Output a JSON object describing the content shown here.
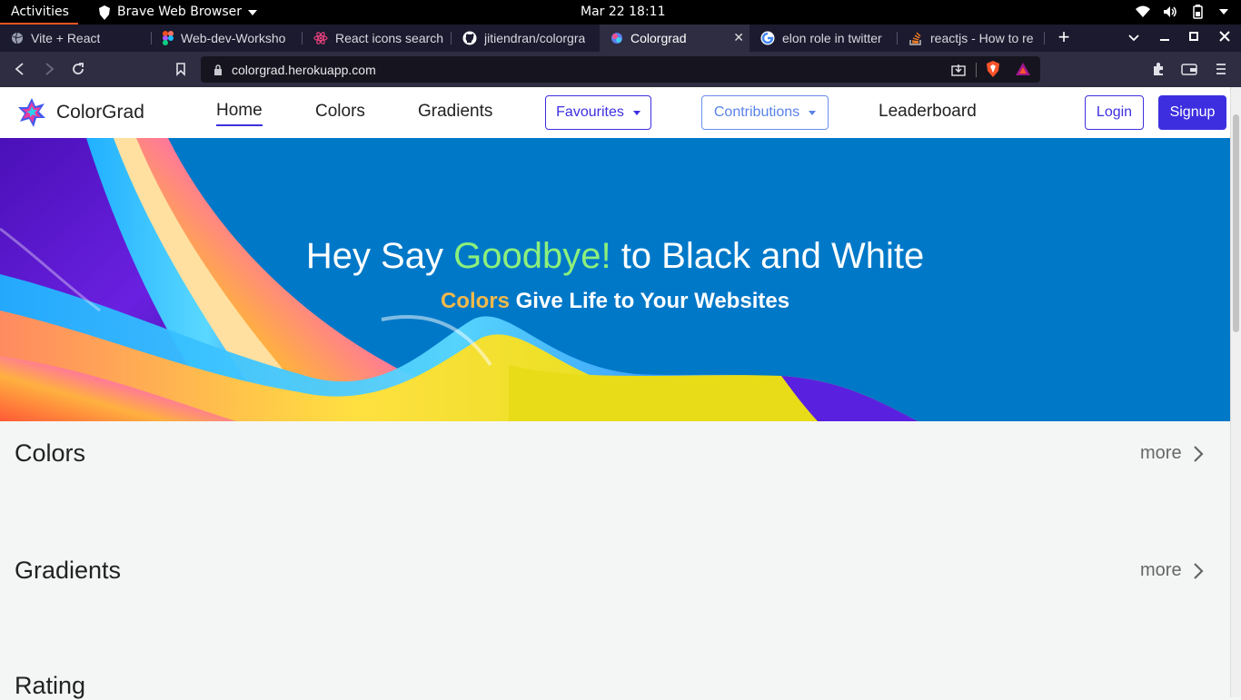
{
  "system": {
    "activities": "Activities",
    "app_name": "Brave Web Browser",
    "clock": "Mar 22  18:11"
  },
  "tabs": [
    {
      "title": "Vite + React",
      "icon": "globe-icon"
    },
    {
      "title": "Web-dev-Worksho",
      "icon": "figma-icon"
    },
    {
      "title": "React icons search",
      "icon": "react-icon"
    },
    {
      "title": "jitiendran/colorgra",
      "icon": "github-icon"
    },
    {
      "title": "Colorgrad",
      "icon": "colorgrad-icon",
      "active": true
    },
    {
      "title": "elon role in twitter",
      "icon": "google-icon"
    },
    {
      "title": "reactjs - How to re",
      "icon": "stackoverflow-icon"
    }
  ],
  "browser": {
    "url": "colorgrad.herokuapp.com"
  },
  "nav": {
    "brand": "ColorGrad",
    "links": {
      "home": "Home",
      "colors": "Colors",
      "gradients": "Gradients",
      "leaderboard": "Leaderboard"
    },
    "favourites": "Favourites",
    "contributions": "Contributions",
    "login": "Login",
    "signup": "Signup"
  },
  "hero": {
    "title_part1": "Hey Say ",
    "title_highlight": "Goodbye!",
    "title_part2": " to Black and White",
    "subtitle_highlight": "Colors",
    "subtitle_rest": " Give Life to Your Websites"
  },
  "sections": {
    "colors": {
      "title": "Colors",
      "more": "more"
    },
    "gradients": {
      "title": "Gradients",
      "more": "more"
    },
    "rating": {
      "title": "Rating"
    }
  },
  "colors": {
    "accent": "#3d2fe0",
    "hero_bg": "#0078c8",
    "hero_highlight": "#8cf07c",
    "subtitle_highlight": "#f3b94a"
  }
}
